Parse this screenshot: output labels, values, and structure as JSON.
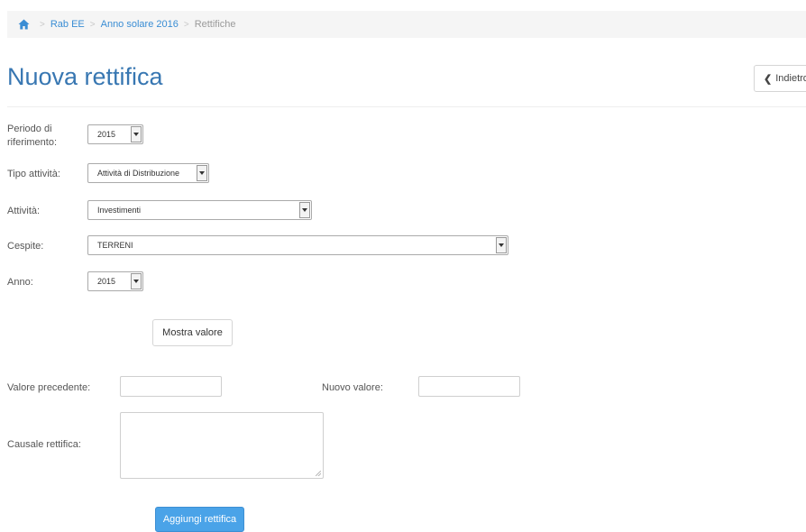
{
  "breadcrumb": {
    "items": [
      {
        "label": "Rab EE"
      },
      {
        "label": "Anno solare 2016"
      },
      {
        "label": "Rettifiche"
      }
    ],
    "separator": ">"
  },
  "page": {
    "title": "Nuova rettifica",
    "back_label": "Indietro"
  },
  "form": {
    "periodo": {
      "label_line1": "Periodo di",
      "label_line2": "riferimento:",
      "value": "2015"
    },
    "tipo_attivita": {
      "label": "Tipo attività:",
      "value": "Attività di Distribuzione"
    },
    "attivita": {
      "label": "Attività:",
      "value": "Investimenti"
    },
    "cespite": {
      "label": "Cespite:",
      "value": "TERRENI"
    },
    "anno": {
      "label": "Anno:",
      "value": "2015"
    },
    "mostra_valore_label": "Mostra valore",
    "valore_precedente": {
      "label": "Valore precedente:",
      "value": ""
    },
    "nuovo_valore": {
      "label": "Nuovo valore:",
      "value": ""
    },
    "causale": {
      "label": "Causale rettifica:",
      "value": ""
    },
    "submit_label": "Aggiungi rettifica"
  },
  "colors": {
    "accent": "#3877b2",
    "link": "#3a8dd4",
    "primary_button": "#4aa3e8"
  }
}
